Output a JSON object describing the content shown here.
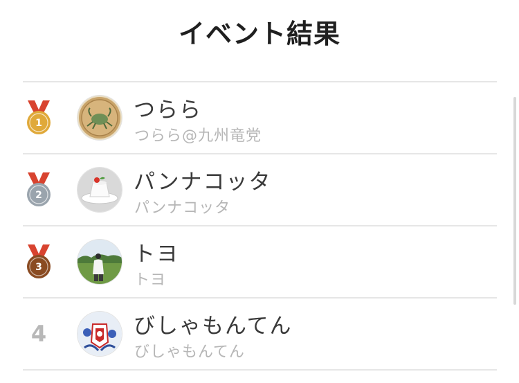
{
  "header": {
    "title": "イベント結果"
  },
  "colors": {
    "gold": "#e0a93a",
    "silver": "#9aa4ad",
    "bronze": "#8a4b22",
    "ribbon": "#d8432f",
    "text_primary": "#3a3a3a",
    "text_secondary": "#b6b6b6",
    "divider": "#e6e6e6"
  },
  "results": [
    {
      "rank": 1,
      "rank_display": "1",
      "badge": "gold-medal-icon",
      "name": "つらら",
      "subname": "つらら@九州竜党",
      "avatar": "crab-coin-avatar"
    },
    {
      "rank": 2,
      "rank_display": "2",
      "badge": "silver-medal-icon",
      "name": "パンナコッタ",
      "subname": "パンナコッタ",
      "avatar": "panna-cotta-avatar"
    },
    {
      "rank": 3,
      "rank_display": "3",
      "badge": "bronze-medal-icon",
      "name": "トヨ",
      "subname": "トヨ",
      "avatar": "field-photo-avatar"
    },
    {
      "rank": 4,
      "rank_display": "4",
      "badge": "",
      "name": "びしゃもんてん",
      "subname": "びしゃもんてん",
      "avatar": "emblem-avatar"
    }
  ]
}
